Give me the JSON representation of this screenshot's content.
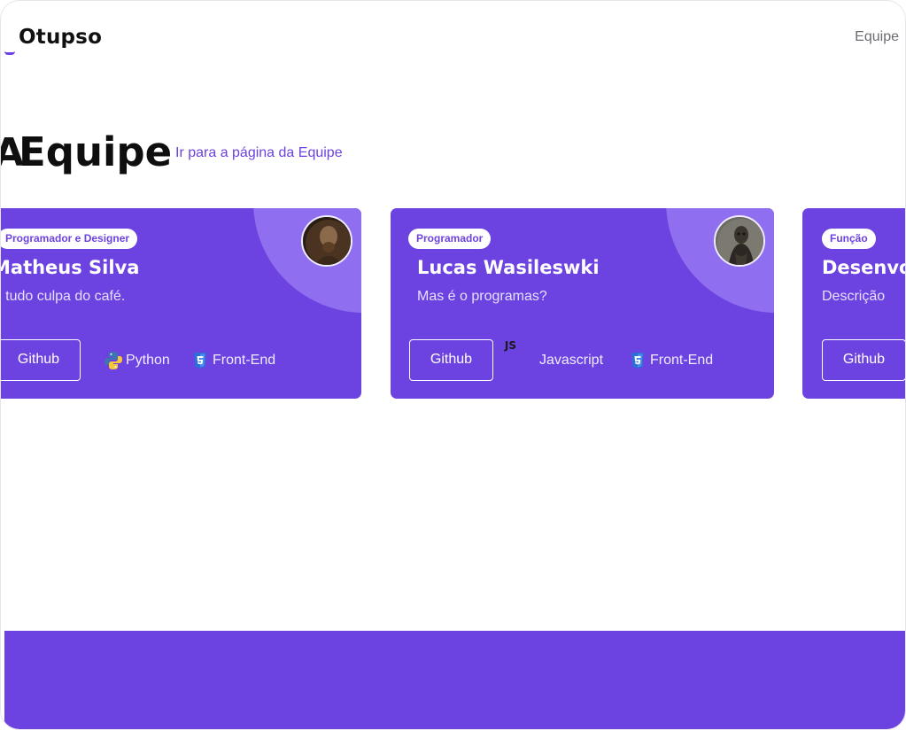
{
  "header": {
    "logo": "Otupso",
    "nav": {
      "equipe": "Equipe"
    }
  },
  "section": {
    "prefix": "A",
    "title": "Equipe",
    "link": "Ir para a página da Equipe"
  },
  "cards": [
    {
      "role": "Programador e Designer",
      "name": "Matheus Silva",
      "description": "É tudo culpa do café.",
      "button": "Github",
      "techs": [
        {
          "label": "Python",
          "icon": "python-icon"
        },
        {
          "label": "Front-End",
          "icon": "css3-icon"
        }
      ]
    },
    {
      "role": "Programador",
      "name": "Lucas Wasileswki",
      "description": "Mas é o programas?",
      "button": "Github",
      "techs": [
        {
          "label": "Javascript",
          "icon": "javascript-icon"
        },
        {
          "label": "Front-End",
          "icon": "css3-icon"
        }
      ]
    },
    {
      "role": "Função",
      "name": "Desenvolvedor",
      "description": "Descrição",
      "button": "Github",
      "techs": []
    }
  ],
  "colors": {
    "accent": "#6c42e0",
    "accent_light": "#8f6ef0",
    "text": "#0e0e0e"
  }
}
